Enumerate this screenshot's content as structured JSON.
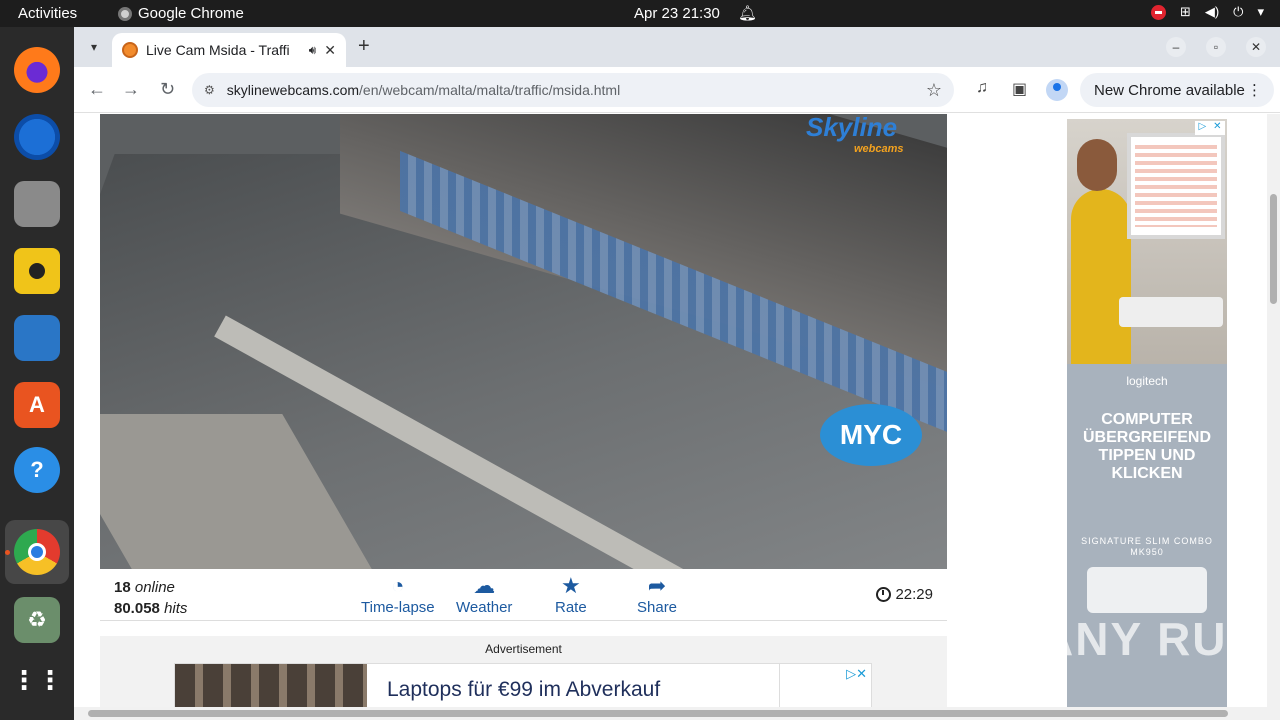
{
  "topbar": {
    "activities": "Activities",
    "app_name": "Google Chrome",
    "datetime": "Apr 23  21:30"
  },
  "dock": {
    "apps": [
      "firefox",
      "thunderbird",
      "files",
      "rhythmbox",
      "writer",
      "app-center",
      "help",
      "chrome",
      "trash",
      "show-apps"
    ]
  },
  "browser": {
    "tab_title": "Live Cam Msida - Traffi",
    "url_host": "skylinewebcams.com",
    "url_path": "/en/webcam/malta/malta/traffic/msida.html",
    "update_label": "New Chrome available"
  },
  "webcam": {
    "brand": "Skyline",
    "brand_sub": "webcams",
    "sponsor_logo": "MYC"
  },
  "stats": {
    "online_count": "18",
    "online_label": "online",
    "hits_count": "80.058",
    "hits_label": "hits",
    "actions": [
      {
        "label": "Time-lapse",
        "icon": "timelapse-icon"
      },
      {
        "label": "Weather",
        "icon": "weather-icon"
      },
      {
        "label": "Rate",
        "icon": "star-icon"
      },
      {
        "label": "Share",
        "icon": "share-icon"
      }
    ],
    "time": "22:29"
  },
  "advertisement": {
    "label": "Advertisement",
    "banner_text": "Laptops für €99 im Abverkauf"
  },
  "side_ad": {
    "brand": "logitech",
    "headline": "COMPUTER ÜBERGREIFEND TIPPEN UND KLICKEN",
    "product": "SIGNATURE SLIM COMBO MK950"
  },
  "watermark": "ANY RUN"
}
